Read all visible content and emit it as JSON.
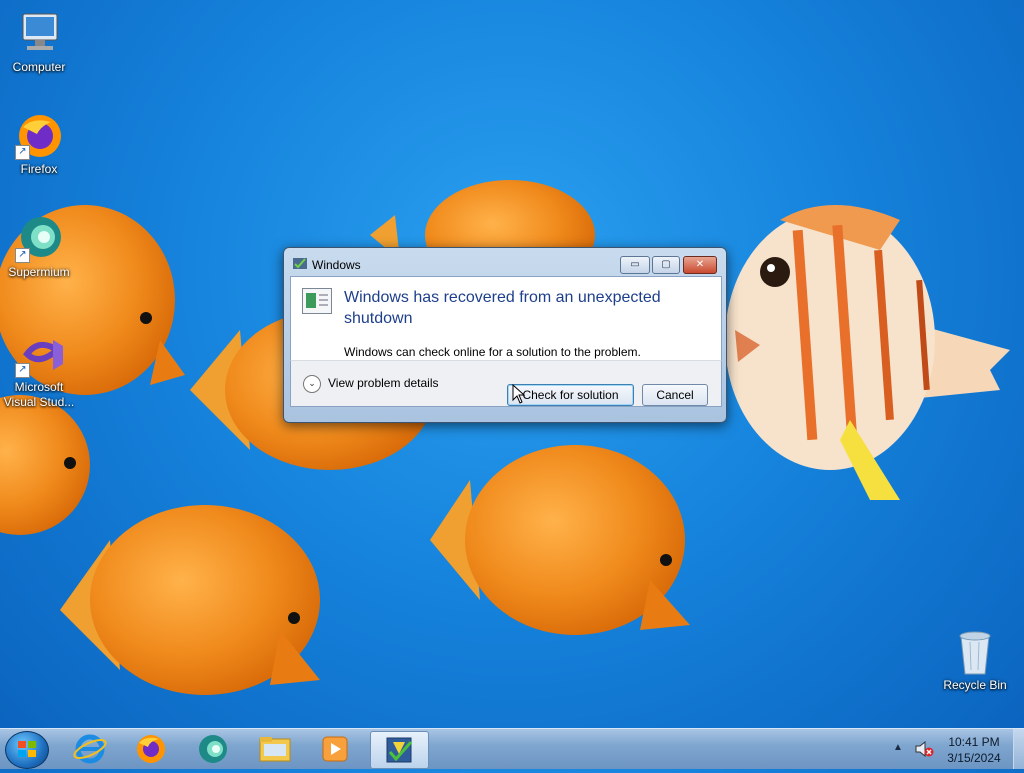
{
  "desktop": {
    "icons": [
      {
        "label": "Computer",
        "icon": "computer-icon"
      },
      {
        "label": "Firefox",
        "icon": "firefox-icon"
      },
      {
        "label": "Supermium",
        "icon": "supermium-icon"
      },
      {
        "label": "Microsoft Visual Stud...",
        "icon": "visual-studio-icon"
      },
      {
        "label": "Recycle Bin",
        "icon": "recycle-bin-icon"
      }
    ]
  },
  "dialog": {
    "title": "Windows",
    "heading": "Windows has recovered from an unexpected shutdown",
    "description": "Windows can check online for a solution to the problem.",
    "details_label": "View problem details",
    "check_button": "Check for solution",
    "cancel_button": "Cancel",
    "minimize_glyph": "▭",
    "maximize_glyph": "▢",
    "close_glyph": "✕",
    "chevron_glyph": "⌄"
  },
  "taskbar": {
    "items": [
      {
        "name": "internet-explorer",
        "icon": "ie-icon"
      },
      {
        "name": "firefox",
        "icon": "firefox-icon"
      },
      {
        "name": "supermium",
        "icon": "supermium-icon"
      },
      {
        "name": "windows-explorer",
        "icon": "folder-icon"
      },
      {
        "name": "media-player",
        "icon": "media-player-icon"
      },
      {
        "name": "problem-reporting",
        "icon": "problem-reports-icon",
        "active": true
      }
    ],
    "tray_arrow": "▲",
    "time": "10:41 PM",
    "date": "3/15/2024"
  },
  "colors": {
    "desktop_blue": "#1683dc",
    "heading_blue": "#1e3f8c",
    "fish_orange": "#f08a1c"
  }
}
